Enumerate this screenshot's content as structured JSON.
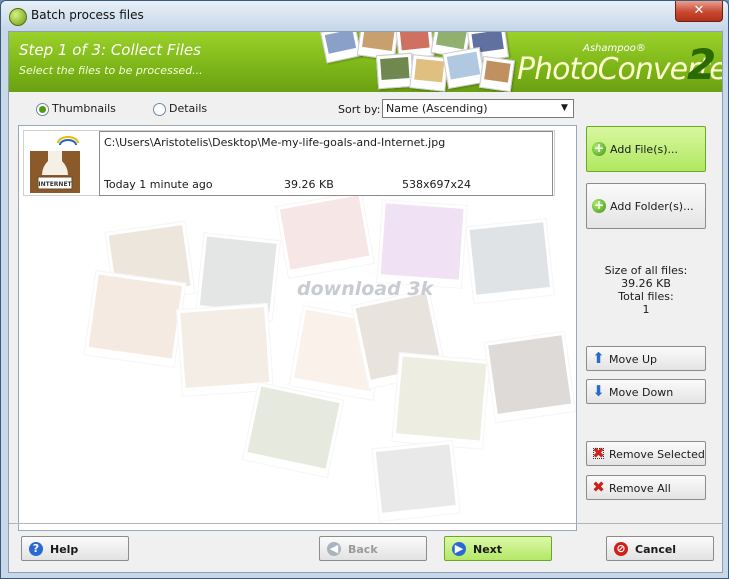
{
  "window": {
    "title": "Batch process files",
    "close_glyph": "✕"
  },
  "header": {
    "step_title": "Step 1 of 3: Collect Files",
    "step_subtitle": "Select the files to be processed...",
    "brand_small": "Ashampoo®",
    "brand_main": "PhotoConverter",
    "brand_version": "2"
  },
  "view": {
    "thumbnails_label": "Thumbnails",
    "details_label": "Details",
    "selected": "thumbnails"
  },
  "sort": {
    "label": "Sort by:",
    "value": "Name (Ascending)",
    "arrow": "▼"
  },
  "watermark": "download 3k",
  "files": [
    {
      "path": "C:\\Users\\Aristotelis\\Desktop\\Me-my-life-goals-and-Internet.jpg",
      "date": "Today 1 minute ago",
      "size": "39.26 KB",
      "dimensions": "538x697x24",
      "thumb_text": "INTERNET"
    }
  ],
  "side": {
    "add_files": "Add File(s)...",
    "add_folder": "Add Folder(s)...",
    "stats_size_label": "Size of all files:",
    "stats_size_value": "39.26 KB",
    "stats_total_label": "Total files:",
    "stats_total_value": "1",
    "move_up": "Move Up",
    "move_down": "Move Down",
    "remove_selected": "Remove Selected",
    "remove_all": "Remove All"
  },
  "footer": {
    "help": "Help",
    "back": "Back",
    "next": "Next",
    "cancel": "Cancel"
  },
  "icons": {
    "plus": "+",
    "arrow_up": "⬆",
    "arrow_down": "⬇",
    "x": "✖",
    "help": "?",
    "back": "◀",
    "next": "▶",
    "cancel": "⊘"
  },
  "colors": {
    "header_green": "#7cb518",
    "accent_highlight": "#b0e860"
  }
}
